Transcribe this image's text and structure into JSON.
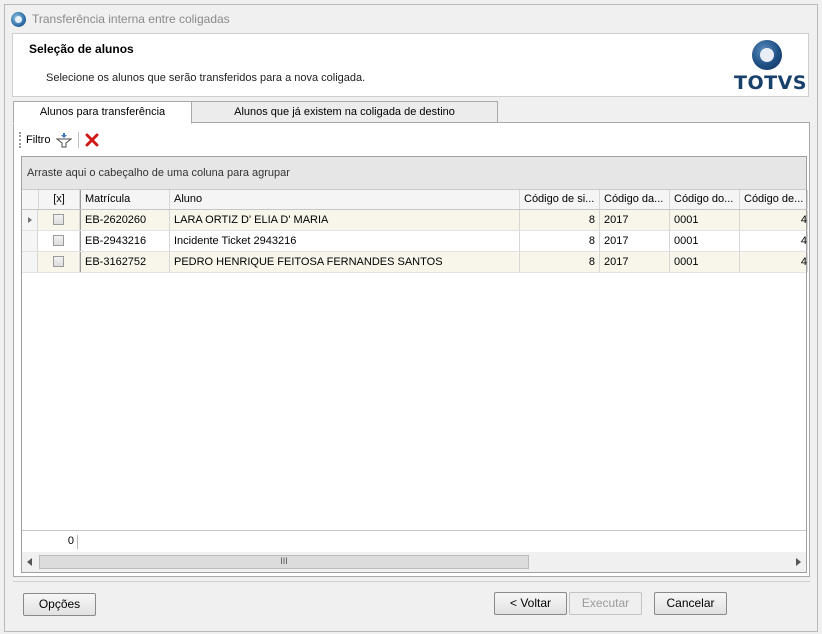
{
  "window": {
    "title": "Transferência interna entre coligadas"
  },
  "header": {
    "title": "Seleção de alunos",
    "subtitle": "Selecione os alunos que serão transferidos para a nova coligada.",
    "logo_text": "TOTVS"
  },
  "tabs": [
    {
      "label": "Alunos para transferência",
      "active": true
    },
    {
      "label": "Alunos que já existem na coligada de destino",
      "active": false
    }
  ],
  "toolbar": {
    "filter_label": "Filtro"
  },
  "grid": {
    "group_hint": "Arraste aqui o cabeçalho de uma coluna para agrupar",
    "columns": [
      "[x]",
      "Matrícula",
      "Aluno",
      "Código de si...",
      "Código da...",
      "Código do...",
      "Código de..."
    ],
    "rows": [
      {
        "checked": false,
        "matricula": "EB-2620260",
        "aluno": "LARA ORTIZ D' ELIA D' MARIA",
        "c1": "8",
        "c2": "2017",
        "c3": "0001",
        "c4": "4"
      },
      {
        "checked": false,
        "matricula": "EB-2943216",
        "aluno": "Incidente Ticket 2943216",
        "c1": "8",
        "c2": "2017",
        "c3": "0001",
        "c4": "4"
      },
      {
        "checked": false,
        "matricula": "EB-3162752",
        "aluno": "PEDRO HENRIQUE FEITOSA FERNANDES SANTOS",
        "c1": "8",
        "c2": "2017",
        "c3": "0001",
        "c4": "4"
      }
    ],
    "footer_count": "0",
    "scroll_thumb_grip": "III"
  },
  "buttons": {
    "options": "Opções",
    "back": "< Voltar",
    "execute": "Executar",
    "cancel": "Cancelar"
  }
}
